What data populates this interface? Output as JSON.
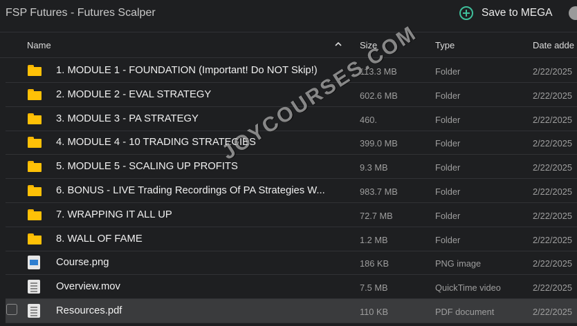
{
  "window": {
    "title": "FSP Futures - Futures Scalper"
  },
  "toolbar": {
    "save_label": "Save to MEGA",
    "save_icon": "plus-circle-icon",
    "accent": "#3fbf9b"
  },
  "table": {
    "headers": {
      "name": "Name",
      "size": "Size",
      "type": "Type",
      "date": "Date adde"
    },
    "rows": [
      {
        "icon": "folder-icon",
        "name": "1. MODULE 1 - FOUNDATION (Important! Do NOT Skip!)",
        "size": "113.3 MB",
        "type": "Folder",
        "date": "2/22/2025"
      },
      {
        "icon": "folder-icon",
        "name": "2. MODULE 2 - EVAL STRATEGY",
        "size": "602.6 MB",
        "type": "Folder",
        "date": "2/22/2025"
      },
      {
        "icon": "folder-icon",
        "name": "3. MODULE 3 - PA STRATEGY",
        "size": "460.",
        "type": "Folder",
        "date": "2/22/2025"
      },
      {
        "icon": "folder-icon",
        "name": "4. MODULE 4 - 10 TRADING STRATEGIES",
        "size": "399.0 MB",
        "type": "Folder",
        "date": "2/22/2025"
      },
      {
        "icon": "folder-icon",
        "name": "5. MODULE 5 - SCALING UP PROFITS",
        "size": "9.3 MB",
        "type": "Folder",
        "date": "2/22/2025"
      },
      {
        "icon": "folder-icon",
        "name": "6. BONUS - LIVE Trading Recordings Of PA Strategies W...",
        "size": "983.7 MB",
        "type": "Folder",
        "date": "2/22/2025"
      },
      {
        "icon": "folder-icon",
        "name": "7. WRAPPING IT ALL UP",
        "size": "72.7 MB",
        "type": "Folder",
        "date": "2/22/2025"
      },
      {
        "icon": "folder-icon",
        "name": "8. WALL OF FAME",
        "size": "1.2 MB",
        "type": "Folder",
        "date": "2/22/2025"
      },
      {
        "icon": "image-file-icon",
        "name": "Course.png",
        "size": "186 KB",
        "type": "PNG image",
        "date": "2/22/2025"
      },
      {
        "icon": "video-file-icon",
        "name": "Overview.mov",
        "size": "7.5 MB",
        "type": "QuickTime video",
        "date": "2/22/2025"
      },
      {
        "icon": "pdf-file-icon",
        "name": "Resources.pdf",
        "size": "110 KB",
        "type": "PDF document",
        "date": "2/22/2025",
        "selected": true
      }
    ]
  },
  "watermark": {
    "text": "JOYCOURSES.COM"
  }
}
